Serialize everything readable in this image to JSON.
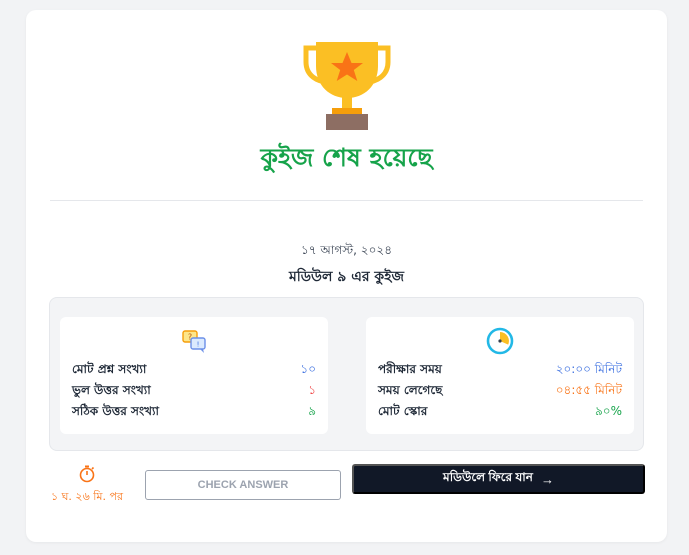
{
  "result": {
    "title": "কুইজ শেষ হয়েছে",
    "date": "১৭ আগস্ট, ২০২৪",
    "module_name": "মডিউল ৯ এর কুইজ"
  },
  "question_stats": {
    "icon": "chat-quiz-icon",
    "rows": [
      {
        "label": "মোট প্রশ্ন সংখ্যা",
        "value": "১০",
        "color": "#3b6fe0"
      },
      {
        "label": "ভুল উত্তর সংখ্যা",
        "value": "১",
        "color": "#ef4444"
      },
      {
        "label": "সঠিক উত্তর সংখ্যা",
        "value": "৯",
        "color": "#16a34a"
      }
    ]
  },
  "time_stats": {
    "icon": "clock-icon",
    "rows": [
      {
        "label": "পরীক্ষার সময়",
        "value": "২০:০০ মিনিট",
        "color": "#3b6fe0"
      },
      {
        "label": "সময় লেগেছে",
        "value": "০৪:৫৫ মিনিট",
        "color": "#f97316"
      },
      {
        "label": "মোট স্কোর",
        "value": "৯০%",
        "color": "#16a34a"
      }
    ]
  },
  "footer": {
    "timer_text": "১ ঘ. ২৬ মি. পর",
    "check_answer_label": "CHECK ANSWER",
    "back_label": "মডিউলে ফিরে যান",
    "back_arrow": "→"
  },
  "colors": {
    "title_green": "#16a34a",
    "primary_dark": "#111827",
    "accent_orange": "#f97316"
  }
}
